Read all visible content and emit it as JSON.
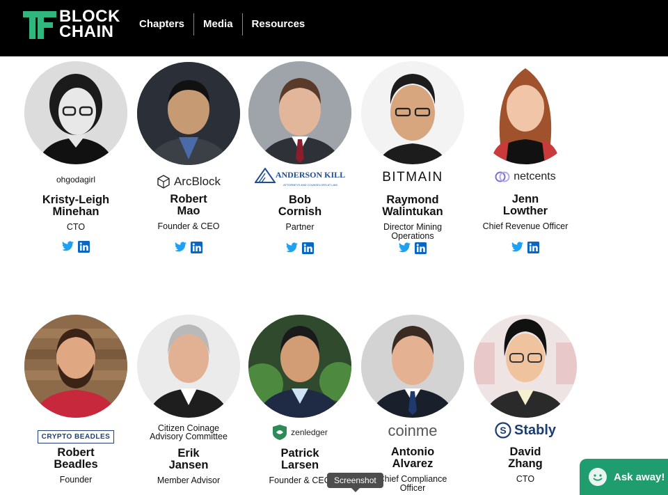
{
  "header": {
    "logo_line1": "BLOCK",
    "logo_line2": "CHAIN",
    "nav": [
      "Chapters",
      "Media",
      "Resources"
    ]
  },
  "colors": {
    "header_bg": "#000000",
    "logo_green": "#2fb77e",
    "twitter": "#1da1f2",
    "linkedin": "#0a66c2",
    "chat_bg": "#1f9d6e"
  },
  "speakers": [
    {
      "first": "Kristy-Leigh",
      "last": "Minehan",
      "role": "CTO",
      "company": "ohgodagirl",
      "photo_bg": "#d9d9d9"
    },
    {
      "first": "Robert",
      "last": "Mao",
      "role": "Founder & CEO",
      "company": "ArcBlock",
      "photo_bg": "#2b2f38"
    },
    {
      "first": "Bob",
      "last": "Cornish",
      "role": "Partner",
      "company": "ANDERSON KILL",
      "company_sub": "ATTORNEYS AND COUNSELORS AT LAW",
      "photo_bg": "#9aa0a6"
    },
    {
      "first": "Raymond",
      "last": "Walintukan",
      "role": "Director Mining Operations",
      "company": "BITMAIN",
      "photo_bg": "#f4f4f4"
    },
    {
      "first": "Jenn",
      "last": "Lowther",
      "role": "Chief Revenue Officer",
      "company": "netcents",
      "photo_bg": "#ffffff"
    },
    {
      "first": "Robert",
      "last": "Beadles",
      "role": "Founder",
      "company": "CRYPTO BEADLES",
      "photo_bg": "#8c6a4a"
    },
    {
      "first": "Erik",
      "last": "Jansen",
      "role": "Member Advisor",
      "company": "Citizen Coinage Advisory Committee",
      "photo_bg": "#e9e9e9"
    },
    {
      "first": "Patrick",
      "last": "Larsen",
      "role": "Founder & CEO",
      "company": "zenledger",
      "photo_bg": "#3f6f3a"
    },
    {
      "first": "Antonio",
      "last": "Alvarez",
      "role": "Chief Compliance Officer",
      "company": "coinme",
      "photo_bg": "#d6d6d6"
    },
    {
      "first": "David",
      "last": "Zhang",
      "role": "CTO",
      "company": "Stably",
      "photo_bg": "#f2e9e9"
    }
  ],
  "tooltip": "Screenshot",
  "chat": {
    "label": "Ask away!"
  }
}
